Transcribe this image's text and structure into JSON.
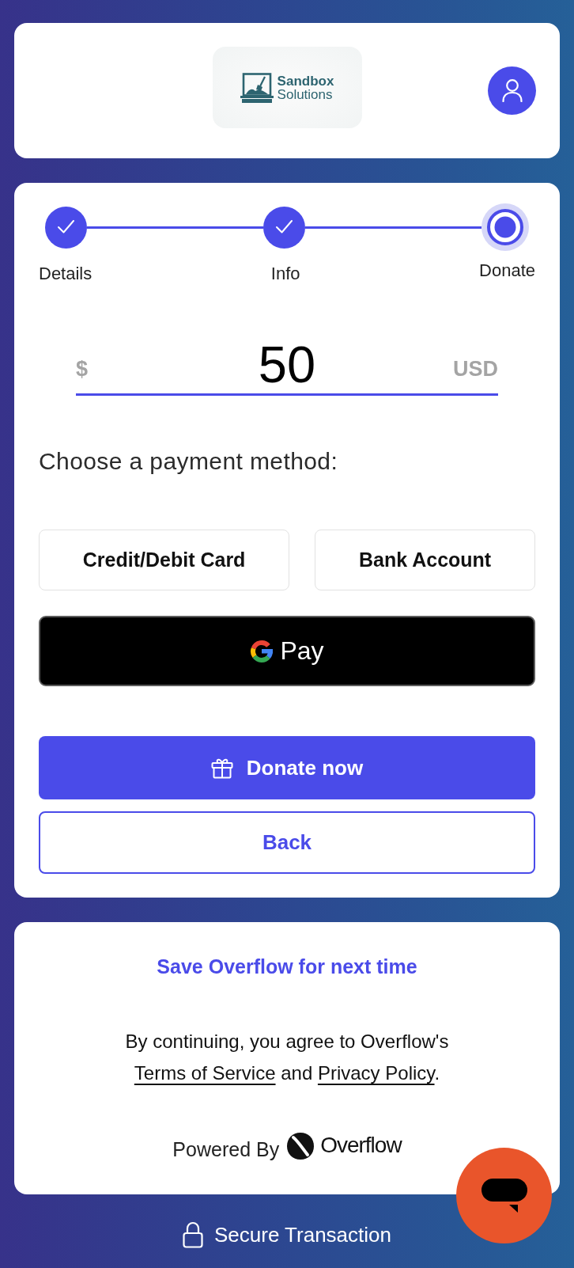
{
  "header": {
    "logo_text": [
      "Sandbox",
      "Solutions"
    ]
  },
  "steps": [
    {
      "label": "Details",
      "completed": true,
      "current": false
    },
    {
      "label": "Info",
      "completed": true,
      "current": false
    },
    {
      "label": "Donate",
      "completed": false,
      "current": true
    }
  ],
  "amount": {
    "currency_symbol": "$",
    "value": "50",
    "currency_code": "USD"
  },
  "payment": {
    "heading": "Choose a payment method:",
    "methods": [
      {
        "kind": "text",
        "label": "Credit/Debit Card",
        "selected": false
      },
      {
        "kind": "text",
        "label": "Bank Account",
        "selected": false
      },
      {
        "kind": "wallet",
        "label": "Pay",
        "selected": false
      }
    ]
  },
  "actions": [
    {
      "kind": "primary",
      "label": "Donate now"
    },
    {
      "kind": "secondary",
      "label": "Back"
    }
  ],
  "footer_card": {
    "save_link": "Save Overflow for next time",
    "legal": [
      {
        "kind": "text",
        "text": "By continuing, you agree to Overflow's "
      },
      {
        "kind": "link",
        "text": "Terms of Service"
      },
      {
        "kind": "text",
        "text": " and "
      },
      {
        "kind": "link",
        "text": "Privacy Policy"
      },
      {
        "kind": "text",
        "text": "."
      }
    ],
    "powered_by": {
      "label": "Powered By",
      "brand": "Overflow"
    }
  },
  "secure_note": "Secure Transaction"
}
